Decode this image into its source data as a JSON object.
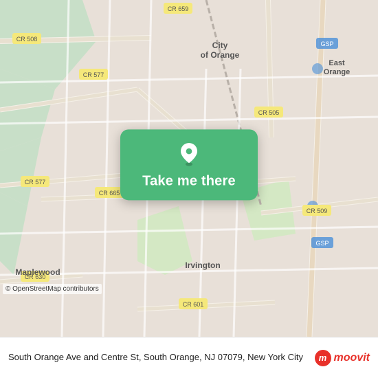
{
  "map": {
    "backgroundColor": "#e8e0d8",
    "pin_icon": "location-pin"
  },
  "card": {
    "button_label": "Take me there",
    "background_color": "#4cb87a"
  },
  "footer": {
    "address": "South Orange Ave and Centre St, South Orange, NJ 07079, New York City",
    "attribution": "© OpenStreetMap contributors",
    "brand_name": "moovit"
  }
}
